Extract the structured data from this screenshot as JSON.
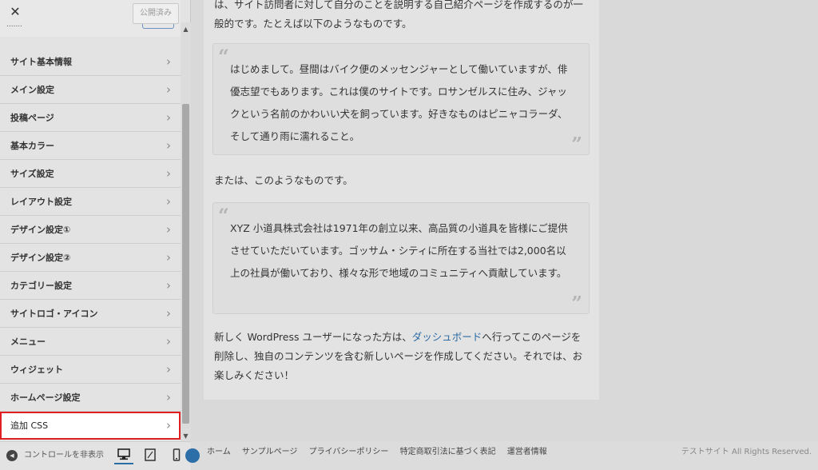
{
  "header": {
    "close_symbol": "✕",
    "publish_label": "公開済み",
    "partial_text": "......."
  },
  "menu": {
    "items": [
      {
        "label": "サイト基本情報"
      },
      {
        "label": "メイン設定"
      },
      {
        "label": "投稿ページ"
      },
      {
        "label": "基本カラー"
      },
      {
        "label": "サイズ設定"
      },
      {
        "label": "レイアウト設定"
      },
      {
        "label": "デザイン設定①"
      },
      {
        "label": "デザイン設定②"
      },
      {
        "label": "カテゴリー設定"
      },
      {
        "label": "サイトロゴ・アイコン"
      },
      {
        "label": "メニュー"
      },
      {
        "label": "ウィジェット"
      },
      {
        "label": "ホームページ設定"
      },
      {
        "label": "追加 CSS"
      }
    ],
    "chevron": "›"
  },
  "sidebar_footer": {
    "collapse_label": "コントロールを非表示"
  },
  "article": {
    "intro": "は、サイト訪問者に対して自分のことを説明する自己紹介ページを作成するのが一般的です。たとえば以下のようなものです。",
    "quote1": "はじめまして。昼間はバイク便のメッセンジャーとして働いていますが、俳優志望でもあります。これは僕のサイトです。ロサンゼルスに住み、ジャックという名前のかわいい犬を飼っています。好きなものはピニャコラーダ、そして通り雨に濡れること。",
    "middle": "または、このようなものです。",
    "quote2": "XYZ 小道具株式会社は1971年の創立以来、高品質の小道具を皆様にご提供させていただいています。ゴッサム・シティに所在する当社では2,000名以上の社員が働いており、様々な形で地域のコミュニティへ貢献しています。",
    "outro_before": "新しく WordPress ユーザーになった方は、",
    "outro_link": "ダッシュボード",
    "outro_after": "へ行ってこのページを削除し、独自のコンテンツを含む新しいページを作成してください。それでは、お楽しみください！",
    "quote_open": "“",
    "quote_close": "”"
  },
  "footer": {
    "links": [
      "ホーム",
      "サンプルページ",
      "プライバシーポリシー",
      "特定商取引法に基づく表記",
      "運営者情報"
    ],
    "copyright": "テストサイト All Rights Reserved."
  },
  "colors": {
    "highlight_border": "#e02020",
    "link": "#2b6aa4",
    "active_device": "#2c6fa8"
  }
}
